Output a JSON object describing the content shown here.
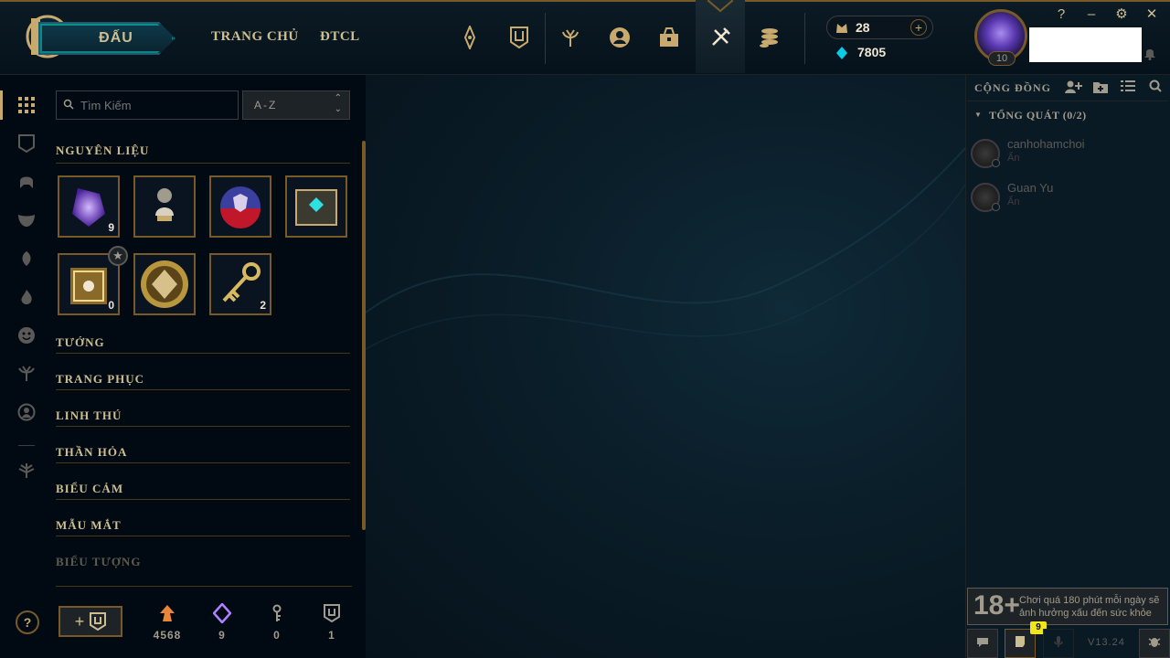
{
  "header": {
    "play_label": "ĐẤU",
    "nav": [
      "TRANG CHỦ",
      "ĐTCL"
    ],
    "rp_value": "28",
    "be_value": "7805",
    "level": "10",
    "win_controls": [
      "?",
      "–",
      "⚙",
      "✕"
    ],
    "icons": [
      "champions-icon",
      "collection-icon",
      "tft-icon",
      "profile-icon",
      "loot-icon",
      "crafting-icon",
      "store-icon"
    ]
  },
  "collection": {
    "search_placeholder": "Tìm Kiếm",
    "sort_value": "A-Z",
    "sections": [
      "NGUYÊN LIỆU",
      "TƯỚNG",
      "TRANG PHỤC",
      "LINH THÚ",
      "THẦN HỎA",
      "BIỂU CẢM",
      "MẪU MẮT",
      "BIỂU TƯỢNG"
    ],
    "materials": [
      {
        "name": "mythic-essence",
        "count": "9"
      },
      {
        "name": "lantern",
        "count": ""
      },
      {
        "name": "orb",
        "count": ""
      },
      {
        "name": "hextech-chest",
        "count": ""
      },
      {
        "name": "masterwork-chest",
        "count": "0"
      },
      {
        "name": "token",
        "count": ""
      },
      {
        "name": "key",
        "count": "2"
      }
    ],
    "resources": [
      {
        "icon": "orange-essence-icon",
        "value": "4568",
        "color": "#e8863a"
      },
      {
        "icon": "mythic-essence-icon",
        "value": "9",
        "color": "#b080ff"
      },
      {
        "icon": "key-fragment-icon",
        "value": "0",
        "color": "#a09b8c"
      },
      {
        "icon": "collection-token-icon",
        "value": "1",
        "color": "#a09b8c"
      }
    ],
    "help_label": "?"
  },
  "social": {
    "title": "CỘNG ĐỒNG",
    "group": "TỔNG QUÁT (0/2)",
    "friends": [
      {
        "name": "canhohamchoi",
        "status": "Ẩn"
      },
      {
        "name": "Guan Yu",
        "status": "Ẩn"
      }
    ],
    "age_label": "18+",
    "age_warning": "Chơi quá 180 phút mỗi ngày sẽ ảnh hưởng xấu đến sức khỏe",
    "badge_count": "9",
    "version": "V13.24"
  }
}
